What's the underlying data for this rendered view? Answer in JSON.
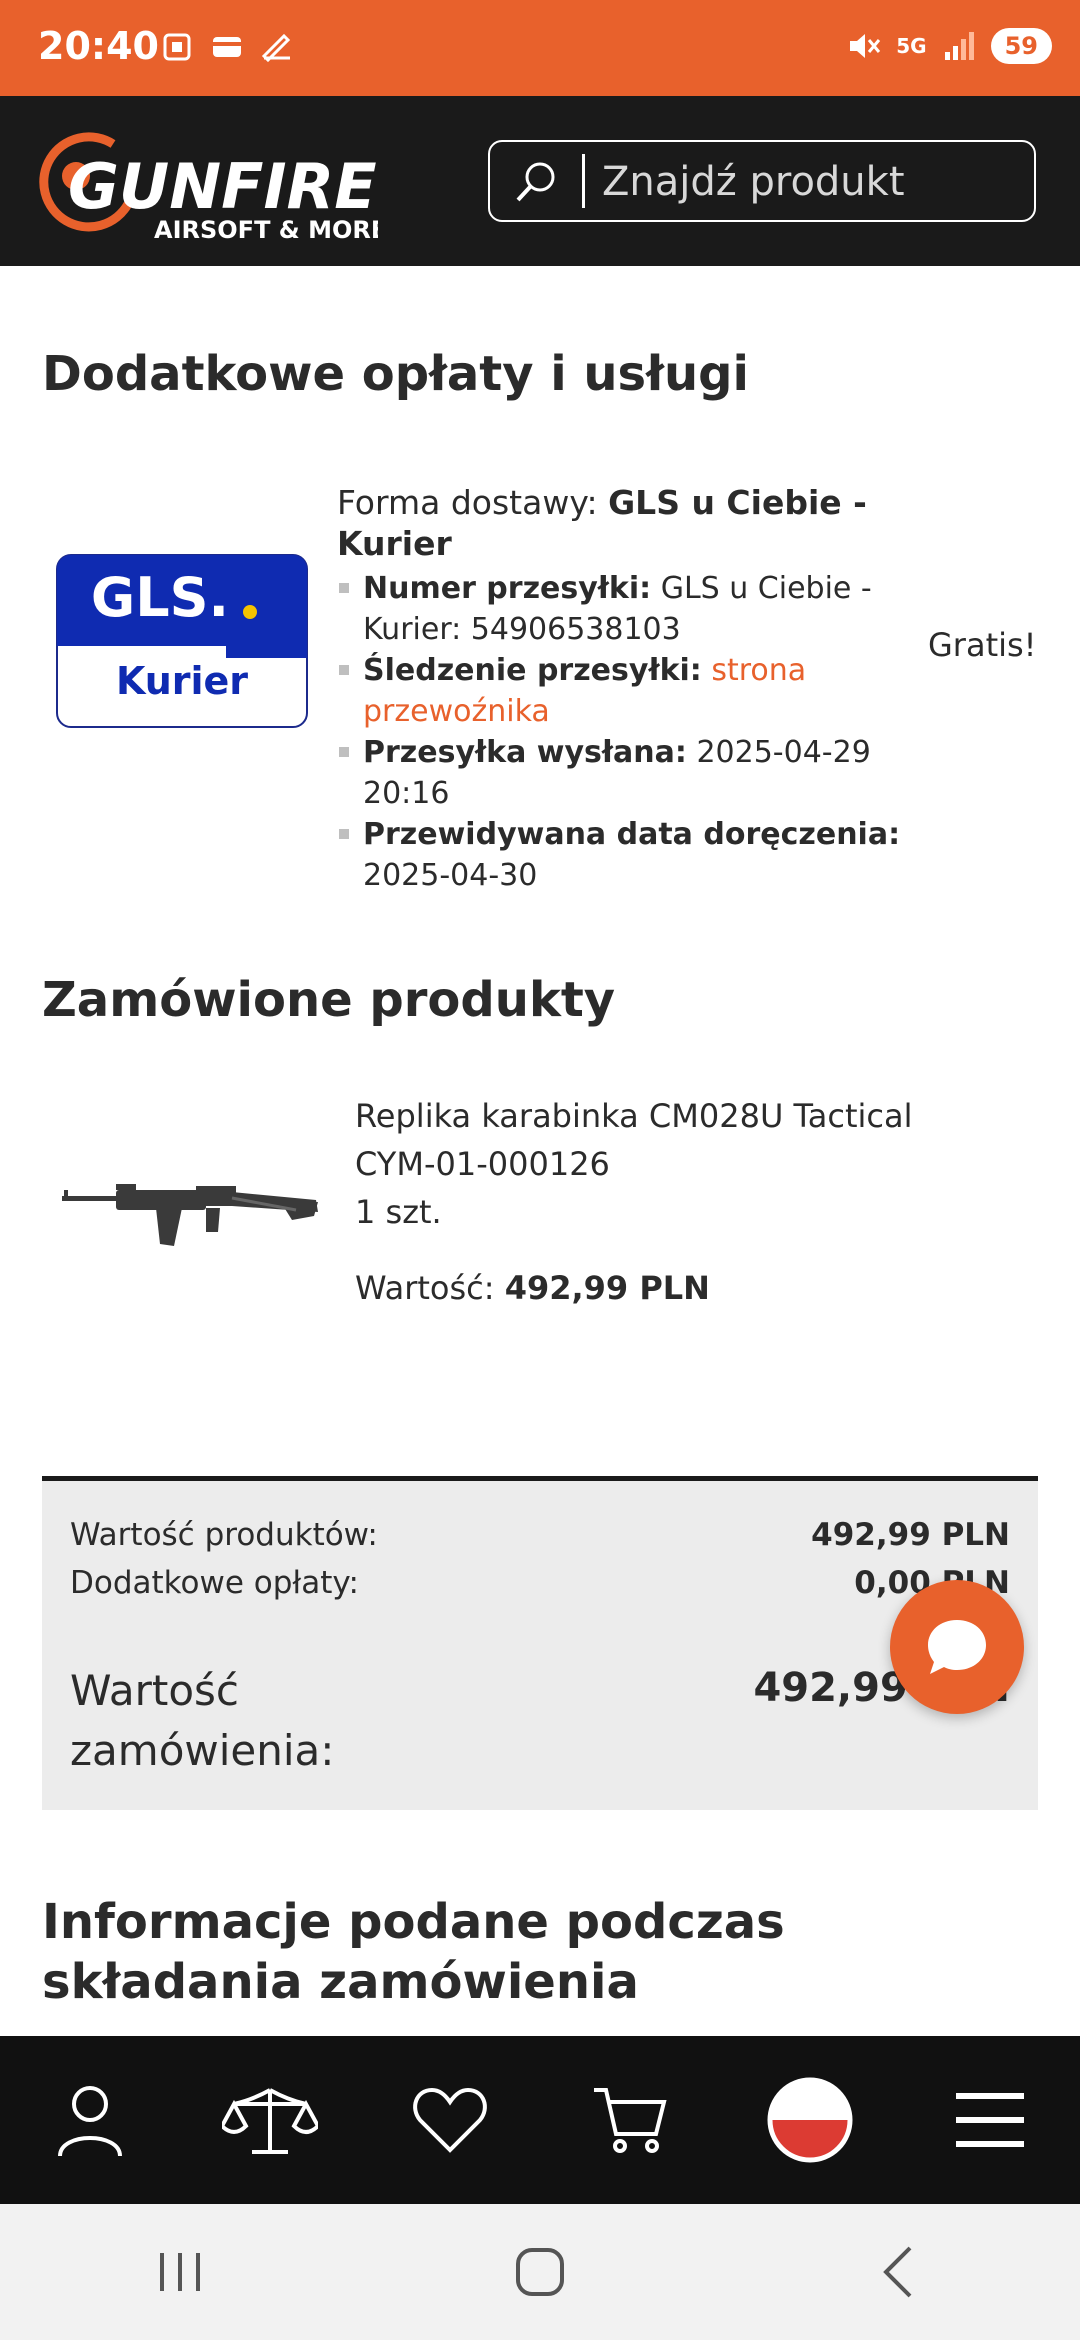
{
  "status_bar": {
    "time": "20:40",
    "network": "5G",
    "battery": "59"
  },
  "header": {
    "brand_main": "GUNFIRE",
    "brand_sub": "AIRSOFT & MORE",
    "search_placeholder": "Znajdź produkt"
  },
  "section_fees": {
    "title": "Dodatkowe opłaty i usługi",
    "carrier_logo_top": "GLS.",
    "carrier_logo_bottom": "Kurier",
    "delivery_label": "Forma dostawy:",
    "delivery_value": "GLS u Ciebie - Kurier",
    "tracking_number_label": "Numer przesyłki:",
    "tracking_number_value": "GLS u Ciebie - Kurier: 54906538103",
    "tracking_label": "Śledzenie przesyłki:",
    "tracking_link": "strona przewoźnika",
    "shipped_label": "Przesyłka wysłana:",
    "shipped_value": "2025-04-29 20:16",
    "eta_label": "Przewidywana data doręczenia:",
    "eta_value": "2025-04-30",
    "price": "Gratis!"
  },
  "section_products": {
    "title": "Zamówione produkty",
    "items": [
      {
        "name": "Replika karabinka CM028U Tactical",
        "code": "CYM-01-000126",
        "quantity": "1 szt.",
        "value_label": "Wartość:",
        "value": "492,99 PLN"
      }
    ]
  },
  "summary": {
    "products_label": "Wartość produktów:",
    "products_value": "492,99 PLN",
    "fees_label": "Dodatkowe opłaty:",
    "fees_value": "0,00 PLN",
    "total_label": "Wartość zamówienia:",
    "total_value": "492,99 PLN"
  },
  "section_info": {
    "title": "Informacje podane podczas składania zamówienia"
  },
  "colors": {
    "accent": "#e8612c",
    "header_bg": "#1a1a1a",
    "summary_bg": "#ececec"
  }
}
